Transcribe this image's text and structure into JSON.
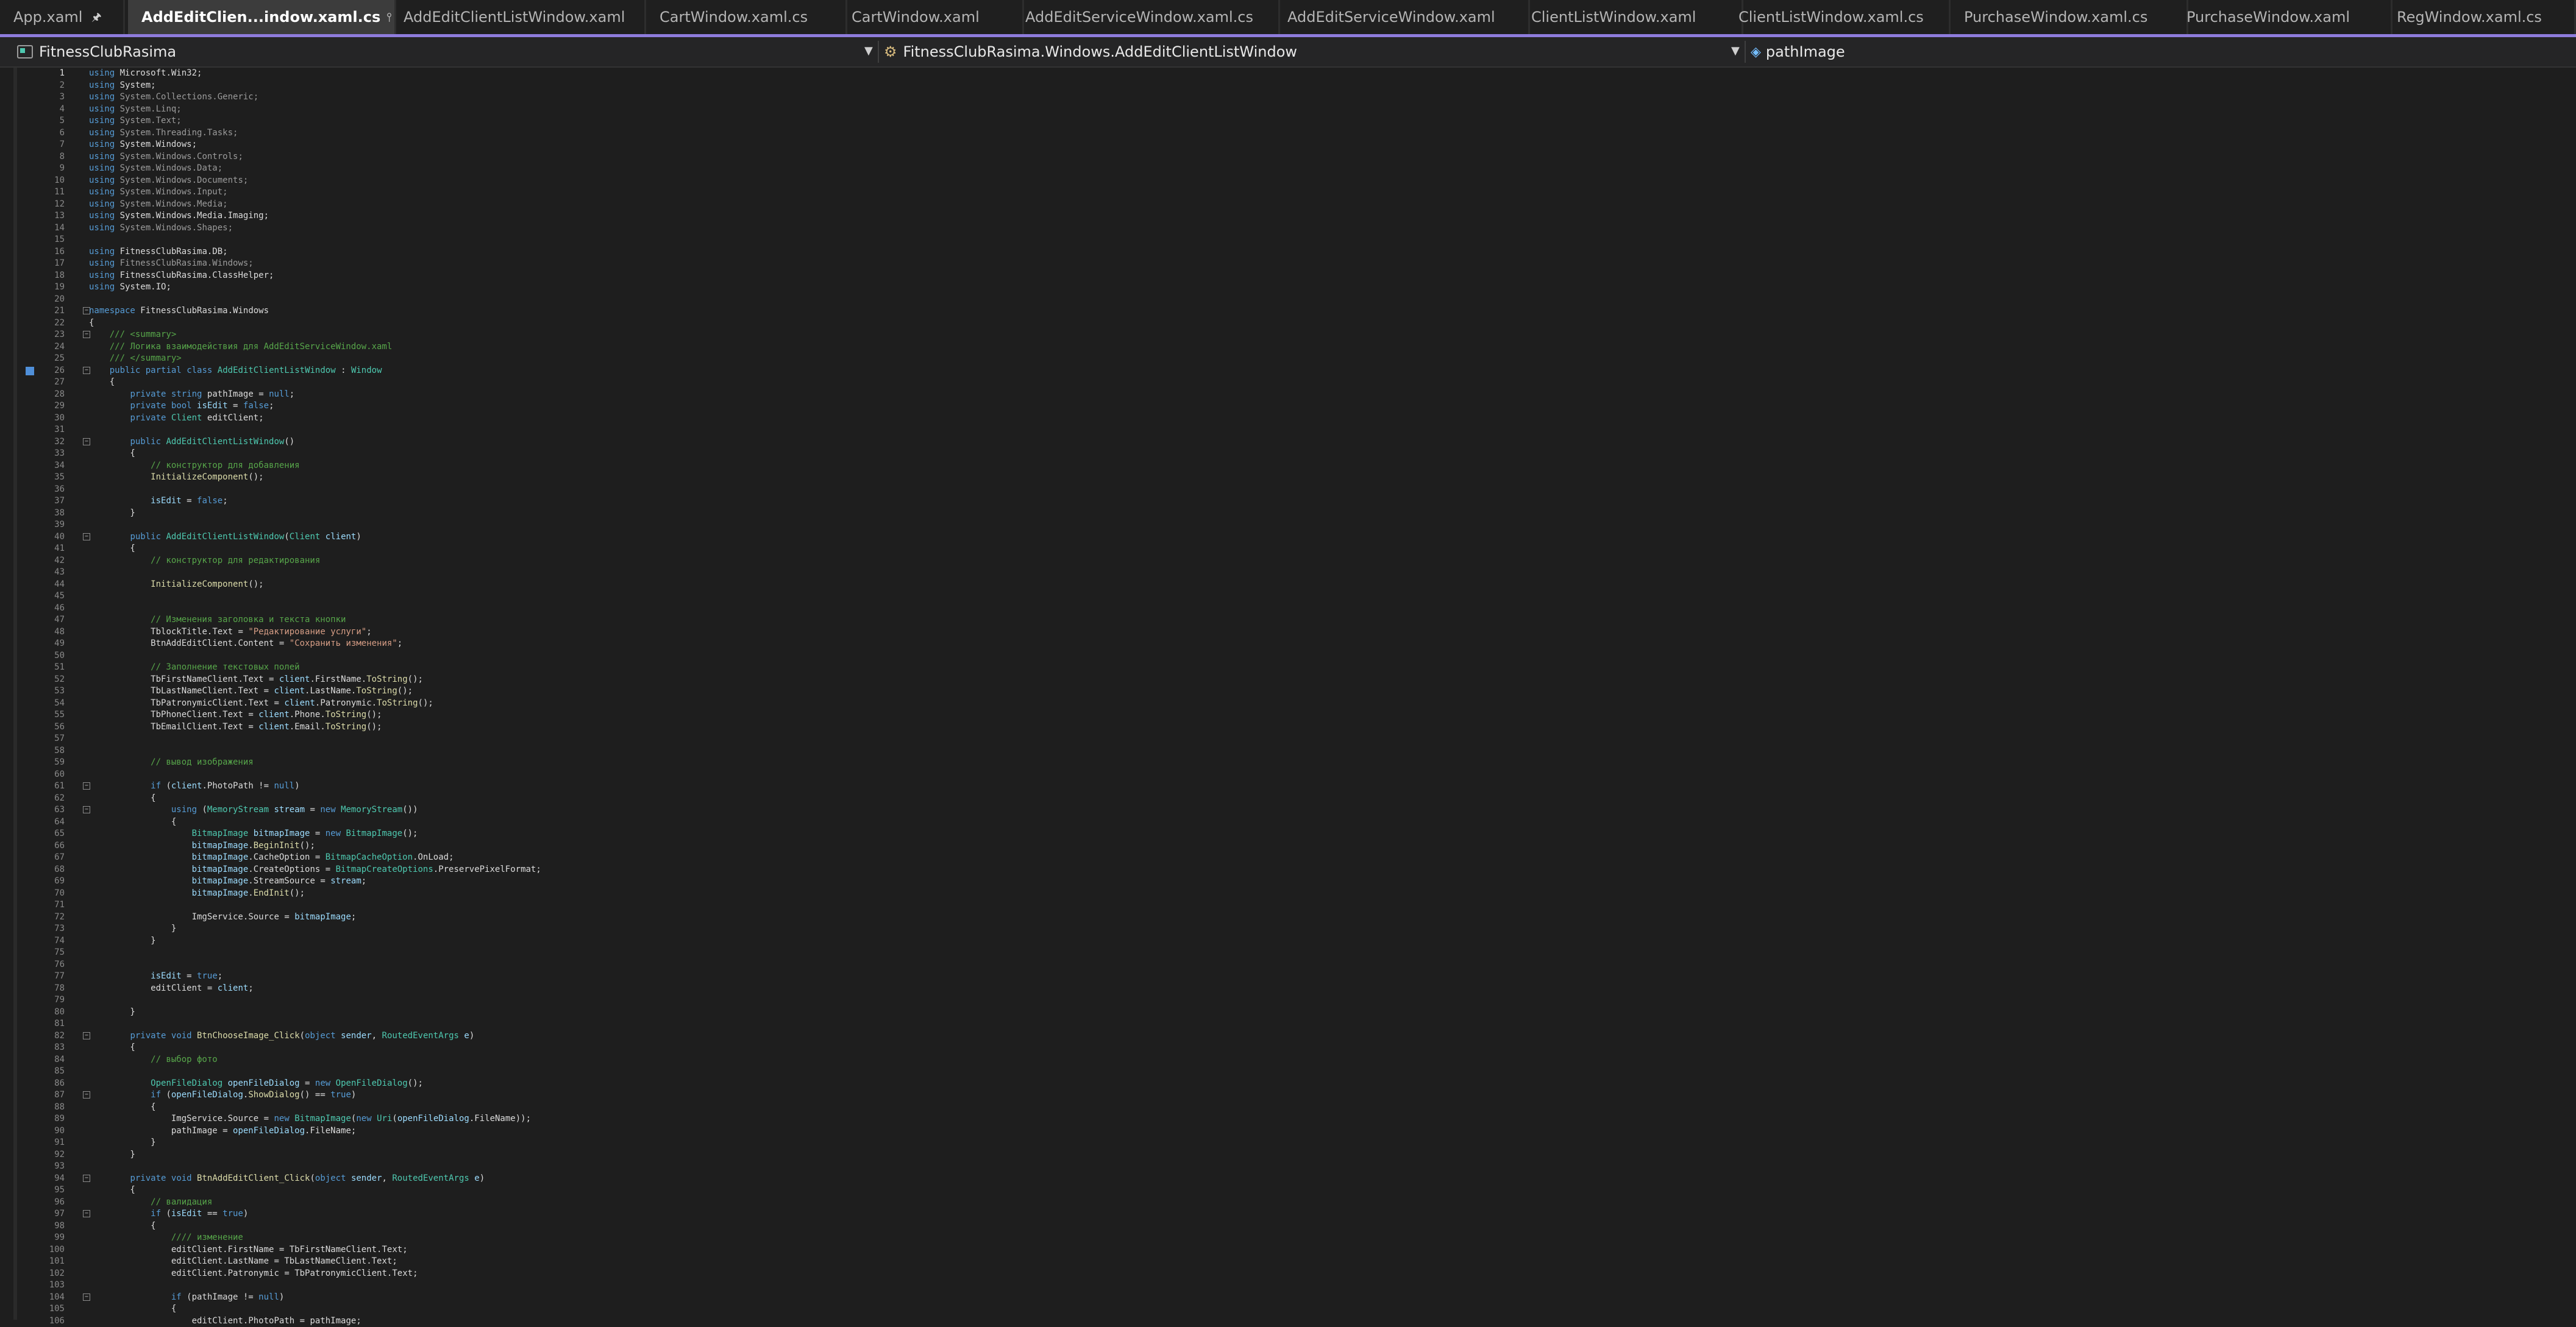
{
  "tabs": [
    {
      "label": "App.xaml",
      "active": false
    },
    {
      "label": "AddEditClien...indow.xaml.cs",
      "active": true
    },
    {
      "label": "AddEditClientListWindow.xaml",
      "active": false
    },
    {
      "label": "CartWindow.xaml.cs",
      "active": false
    },
    {
      "label": "CartWindow.xaml",
      "active": false
    },
    {
      "label": "AddEditServiceWindow.xaml.cs",
      "active": false
    },
    {
      "label": "AddEditServiceWindow.xaml",
      "active": false
    },
    {
      "label": "ClientListWindow.xaml",
      "active": false
    },
    {
      "label": "ClientListWindow.xaml.cs",
      "active": false
    },
    {
      "label": "PurchaseWindow.xaml.cs",
      "active": false
    },
    {
      "label": "PurchaseWindow.xaml",
      "active": false
    },
    {
      "label": "RegWindow.xaml.cs",
      "active": false
    }
  ],
  "navbar": {
    "project": "FitnessClubRasima",
    "class": "FitnessClubRasima.Windows.AddEditClientListWindow",
    "member": "pathImage"
  },
  "colors": {
    "accent": "#8f7cdc",
    "keyword": "#569cd6",
    "type": "#4ec9b0",
    "method": "#dcdcaa",
    "string": "#d69d85",
    "comment": "#57a64a",
    "local": "#9cdcfe"
  },
  "icons": {
    "pin": "pin-icon",
    "close": "close-icon",
    "project": "csharp-project-icon",
    "class": "class-icon",
    "field": "field-icon"
  },
  "lines": [
    {
      "n": 1,
      "t": "using Microsoft.Win32;"
    },
    {
      "n": 2,
      "t": "using System;"
    },
    {
      "n": 3,
      "t": "using System.Collections.Generic;"
    },
    {
      "n": 4,
      "t": "using System.Linq;"
    },
    {
      "n": 5,
      "t": "using System.Text;"
    },
    {
      "n": 6,
      "t": "using System.Threading.Tasks;"
    },
    {
      "n": 7,
      "t": "using System.Windows;"
    },
    {
      "n": 8,
      "t": "using System.Windows.Controls;"
    },
    {
      "n": 9,
      "t": "using System.Windows.Data;"
    },
    {
      "n": 10,
      "t": "using System.Windows.Documents;"
    },
    {
      "n": 11,
      "t": "using System.Windows.Input;"
    },
    {
      "n": 12,
      "t": "using System.Windows.Media;"
    },
    {
      "n": 13,
      "t": "using System.Windows.Media.Imaging;"
    },
    {
      "n": 14,
      "t": "using System.Windows.Shapes;"
    },
    {
      "n": 15,
      "t": ""
    },
    {
      "n": 16,
      "t": "using FitnessClubRasima.DB;"
    },
    {
      "n": 17,
      "t": "using FitnessClubRasima.Windows;"
    },
    {
      "n": 18,
      "t": "using FitnessClubRasima.ClassHelper;"
    },
    {
      "n": 19,
      "t": "using System.IO;"
    },
    {
      "n": 20,
      "t": ""
    },
    {
      "n": 21,
      "t": "namespace FitnessClubRasima.Windows"
    },
    {
      "n": 22,
      "t": "{"
    },
    {
      "n": 23,
      "t": "    /// <summary>"
    },
    {
      "n": 24,
      "t": "    /// Логика взаимодействия для AddEditServiceWindow.xaml"
    },
    {
      "n": 25,
      "t": "    /// </summary>"
    },
    {
      "n": 26,
      "t": "    public partial class AddEditClientListWindow : Window"
    },
    {
      "n": 27,
      "t": "    {"
    },
    {
      "n": 28,
      "t": "        private string pathImage = null;"
    },
    {
      "n": 29,
      "t": "        private bool isEdit = false;"
    },
    {
      "n": 30,
      "t": "        private Client editClient;"
    },
    {
      "n": 31,
      "t": ""
    },
    {
      "n": 32,
      "t": "        public AddEditClientListWindow()"
    },
    {
      "n": 33,
      "t": "        {"
    },
    {
      "n": 34,
      "t": "            // конструктор для добавления"
    },
    {
      "n": 35,
      "t": "            InitializeComponent();"
    },
    {
      "n": 36,
      "t": ""
    },
    {
      "n": 37,
      "t": "            isEdit = false;"
    },
    {
      "n": 38,
      "t": "        }"
    },
    {
      "n": 39,
      "t": ""
    },
    {
      "n": 40,
      "t": "        public AddEditClientListWindow(Client client)"
    },
    {
      "n": 41,
      "t": "        {"
    },
    {
      "n": 42,
      "t": "            // конструктор для редактирования"
    },
    {
      "n": 43,
      "t": ""
    },
    {
      "n": 44,
      "t": "            InitializeComponent();"
    },
    {
      "n": 45,
      "t": ""
    },
    {
      "n": 46,
      "t": ""
    },
    {
      "n": 47,
      "t": "            // Изменения заголовка и текста кнопки"
    },
    {
      "n": 48,
      "t": "            TblockTitle.Text = \"Редактирование услуги\";"
    },
    {
      "n": 49,
      "t": "            BtnAddEditClient.Content = \"Сохранить изменения\";"
    },
    {
      "n": 50,
      "t": ""
    },
    {
      "n": 51,
      "t": "            // Заполнение текстовых полей"
    },
    {
      "n": 52,
      "t": "            TbFirstNameClient.Text = client.FirstName.ToString();"
    },
    {
      "n": 53,
      "t": "            TbLastNameClient.Text = client.LastName.ToString();"
    },
    {
      "n": 54,
      "t": "            TbPatronymicClient.Text = client.Patronymic.ToString();"
    },
    {
      "n": 55,
      "t": "            TbPhoneClient.Text = client.Phone.ToString();"
    },
    {
      "n": 56,
      "t": "            TbEmailClient.Text = client.Email.ToString();"
    },
    {
      "n": 57,
      "t": ""
    },
    {
      "n": 58,
      "t": ""
    },
    {
      "n": 59,
      "t": "            // вывод изображения"
    },
    {
      "n": 60,
      "t": ""
    },
    {
      "n": 61,
      "t": "            if (client.PhotoPath != null)"
    },
    {
      "n": 62,
      "t": "            {"
    },
    {
      "n": 63,
      "t": "                using (MemoryStream stream = new MemoryStream())"
    },
    {
      "n": 64,
      "t": "                {"
    },
    {
      "n": 65,
      "t": "                    BitmapImage bitmapImage = new BitmapImage();"
    },
    {
      "n": 66,
      "t": "                    bitmapImage.BeginInit();"
    },
    {
      "n": 67,
      "t": "                    bitmapImage.CacheOption = BitmapCacheOption.OnLoad;"
    },
    {
      "n": 68,
      "t": "                    bitmapImage.CreateOptions = BitmapCreateOptions.PreservePixelFormat;"
    },
    {
      "n": 69,
      "t": "                    bitmapImage.StreamSource = stream;"
    },
    {
      "n": 70,
      "t": "                    bitmapImage.EndInit();"
    },
    {
      "n": 71,
      "t": ""
    },
    {
      "n": 72,
      "t": "                    ImgService.Source = bitmapImage;"
    },
    {
      "n": 73,
      "t": "                }"
    },
    {
      "n": 74,
      "t": "            }"
    },
    {
      "n": 75,
      "t": ""
    },
    {
      "n": 76,
      "t": ""
    },
    {
      "n": 77,
      "t": "            isEdit = true;"
    },
    {
      "n": 78,
      "t": "            editClient = client;"
    },
    {
      "n": 79,
      "t": ""
    },
    {
      "n": 80,
      "t": "        }"
    },
    {
      "n": 81,
      "t": ""
    },
    {
      "n": 82,
      "t": "        private void BtnChooseImage_Click(object sender, RoutedEventArgs e)"
    },
    {
      "n": 83,
      "t": "        {"
    },
    {
      "n": 84,
      "t": "            // выбор фото"
    },
    {
      "n": 85,
      "t": ""
    },
    {
      "n": 86,
      "t": "            OpenFileDialog openFileDialog = new OpenFileDialog();"
    },
    {
      "n": 87,
      "t": "            if (openFileDialog.ShowDialog() == true)"
    },
    {
      "n": 88,
      "t": "            {"
    },
    {
      "n": 89,
      "t": "                ImgService.Source = new BitmapImage(new Uri(openFileDialog.FileName));"
    },
    {
      "n": 90,
      "t": "                pathImage = openFileDialog.FileName;"
    },
    {
      "n": 91,
      "t": "            }"
    },
    {
      "n": 92,
      "t": "        }"
    },
    {
      "n": 93,
      "t": ""
    },
    {
      "n": 94,
      "t": "        private void BtnAddEditClient_Click(object sender, RoutedEventArgs e)"
    },
    {
      "n": 95,
      "t": "        {"
    },
    {
      "n": 96,
      "t": "            // валидация"
    },
    {
      "n": 97,
      "t": "            if (isEdit == true)"
    },
    {
      "n": 98,
      "t": "            {"
    },
    {
      "n": 99,
      "t": "                //// изменение"
    },
    {
      "n": 100,
      "t": "                editClient.FirstName = TbFirstNameClient.Text;"
    },
    {
      "n": 101,
      "t": "                editClient.LastName = TbLastNameClient.Text;"
    },
    {
      "n": 102,
      "t": "                editClient.Patronymic = TbPatronymicClient.Text;"
    },
    {
      "n": 103,
      "t": ""
    },
    {
      "n": 104,
      "t": "                if (pathImage != null)"
    },
    {
      "n": 105,
      "t": "                {"
    },
    {
      "n": 106,
      "t": "                    editClient.PhotoPath = pathImage;"
    }
  ]
}
